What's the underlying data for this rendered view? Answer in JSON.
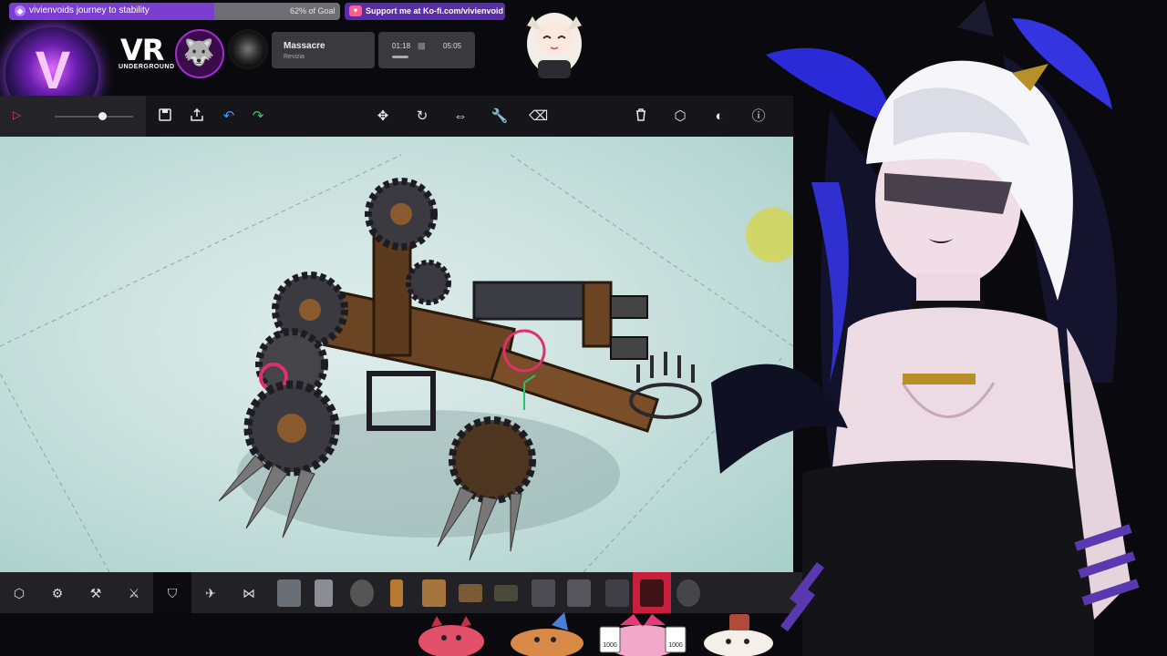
{
  "overlay": {
    "goal": {
      "title": "vivienvoids journey to stability",
      "percent_text": "62% of Goal",
      "percent": 62
    },
    "kofi": {
      "text": "Support me at Ko-fi.com/vivienvoid",
      "icon": "kofi-cup-icon"
    },
    "logos": {
      "channel": "V",
      "vr_main": "VR",
      "vr_sub": "UNDERGROUND"
    },
    "now_playing": {
      "title": "Massacre",
      "artist": "Revizia",
      "current": "01:18",
      "total": "05:05",
      "progress": 0.26
    }
  },
  "toolbar": {
    "left": [
      "play-icon",
      "save-icon",
      "load-icon",
      "undo-icon",
      "redo-icon"
    ],
    "center": [
      "move-icon",
      "rotate-icon",
      "flip-icon",
      "wrench-icon",
      "eraser-icon"
    ],
    "right": [
      "trash-icon",
      "hexagon-icon",
      "toggle-icon",
      "info-icon"
    ],
    "time_scale": 0.6
  },
  "blockbar": {
    "categories": [
      "hexagon-icon",
      "gear-category-icon",
      "mechanical-icon",
      "weapon-icon",
      "armor-icon",
      "flight-icon",
      "nodes-icon"
    ],
    "active_category": "armor-icon",
    "blocks": [
      "plate-block",
      "half-pipe-block",
      "wheel-block",
      "wood-pole-block",
      "wood-panel-block",
      "grabber-block",
      "cannon-block",
      "spike-block",
      "crate-block",
      "ballista-block",
      "wing-block",
      "active-spike-block",
      "spike-ball-block"
    ],
    "active_block": "active-spike-block"
  },
  "emotes": [
    "devil-cat-emote",
    "party-cat-emote",
    "clown-1000-emote",
    "bucket-cat-emote"
  ],
  "emote_badges": [
    "1000",
    "1000"
  ],
  "colors": {
    "accent": "#7b3fd0",
    "kofi": "#5a2da8",
    "active_block": "#c8203c",
    "toolbar": "#16161a"
  }
}
